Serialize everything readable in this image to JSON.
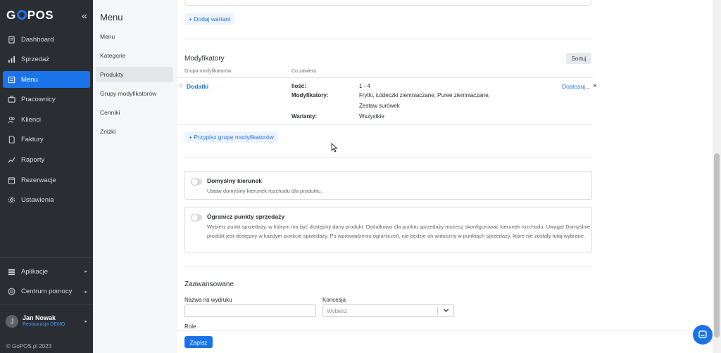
{
  "sidebar": {
    "logo": "GoPOS",
    "collapse_icon": "«",
    "items": [
      {
        "label": "Dashboard",
        "icon": "dashboard-icon"
      },
      {
        "label": "Sprzedaż",
        "icon": "sales-icon"
      },
      {
        "label": "Menu",
        "icon": "menu-icon"
      },
      {
        "label": "Pracownicy",
        "icon": "employees-icon"
      },
      {
        "label": "Klienci",
        "icon": "clients-icon"
      },
      {
        "label": "Faktury",
        "icon": "invoices-icon"
      },
      {
        "label": "Raporty",
        "icon": "reports-icon"
      },
      {
        "label": "Rezerwacje",
        "icon": "reservations-icon"
      },
      {
        "label": "Ustawienia",
        "icon": "settings-icon"
      }
    ],
    "bottom_items": [
      {
        "label": "Aplikacje",
        "icon": "apps-icon"
      },
      {
        "label": "Centrum pomocy",
        "icon": "help-icon"
      }
    ],
    "user": {
      "initial": "J",
      "name": "Jan Nowak",
      "org": "Restauracja DEMO"
    },
    "copyright": "© GoPOS.pl 2023",
    "accent": "#1a73e8"
  },
  "submenu": {
    "title": "Menu",
    "items": [
      "Menu",
      "Kategorie",
      "Produkty",
      "Grupy modyfikatorów",
      "Cenniki",
      "Zniżki"
    ],
    "active": "Produkty"
  },
  "main": {
    "add_variant": "+ Dodaj wariant",
    "modifiers": {
      "title": "Modyfikatory",
      "sort_label": "Sortuj",
      "col_group": "Grupa modyfikatorów",
      "col_contains": "Co zawiera",
      "row": {
        "name": "Dodatki",
        "qty_label": "Ilość:",
        "qty_value": "1 - 4",
        "mods_label": "Modyfikatory:",
        "mods_value_line1": "Frytki, Łódeczki ziemniaczane, Puree ziemniaczane,",
        "mods_value_line2": "Zestaw surówek",
        "variants_label": "Warianty:",
        "variants_value": "Wszystkie",
        "customize": "Dostosuj...",
        "remove": "×"
      },
      "assign": "+ Przypisz grupę modyfikatorów"
    },
    "direction": {
      "title": "Domyślny kierunek",
      "desc": "Ustaw domyślny kierunek rozchodu dla produktu."
    },
    "points": {
      "title": "Ogranicz punkty sprzedaży",
      "desc": "Wybierz punkt sprzedaży, w którym ma być dostępny dany produkt. Dodatkowo dla punktu sprzedaży możesz skonfigurować kierunek rozchodu. Uwaga! Domyślnie produkt jest dostępny w każdym punkcie sprzedaży. Po wprowadzeniu ograniczeń, nie będzie on widoczny w punktach sprzedaży, które nie zostały tutaj wybrane."
    },
    "advanced": {
      "title": "Zaawansowane",
      "print_name_label": "Nazwa na wydruku",
      "print_name_value": "",
      "concession_label": "Koncesja",
      "concession_placeholder": "Wybierz",
      "role_label": "Role"
    },
    "save_label": "Zapisz"
  }
}
